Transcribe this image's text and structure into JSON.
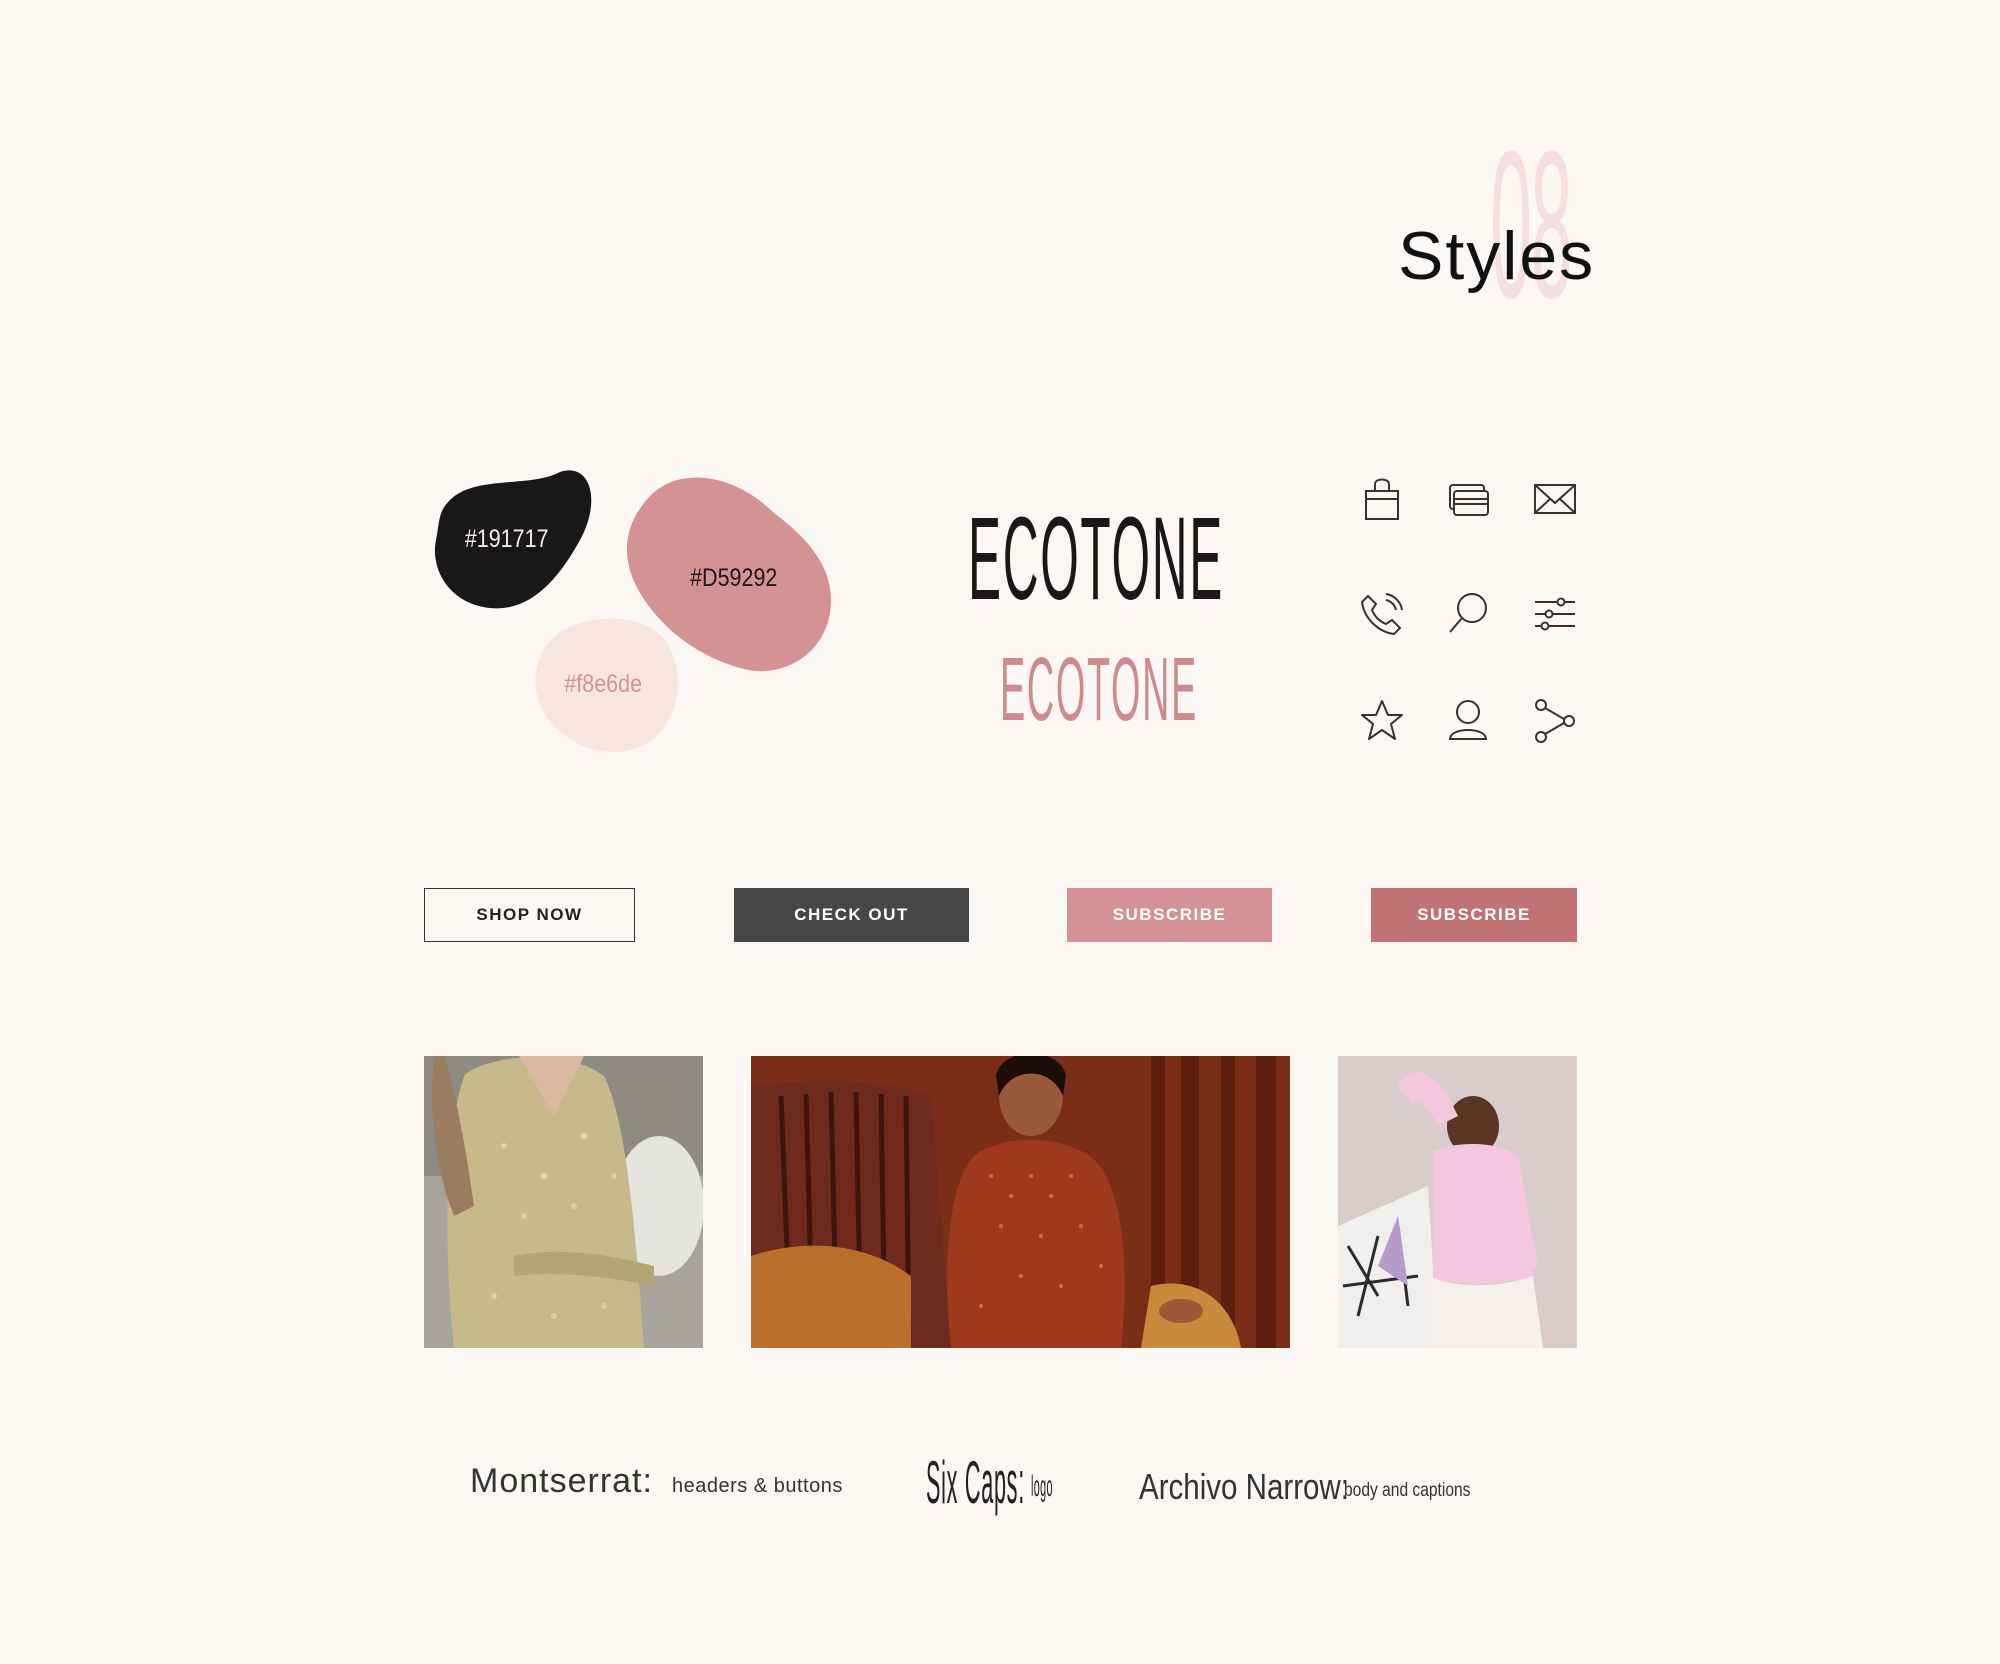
{
  "header": {
    "section_number": "08",
    "title": "Styles"
  },
  "palette": [
    {
      "label": "#191717",
      "color": "#191717",
      "text_color": "#f4ece8"
    },
    {
      "label": "#D59292",
      "color": "#D59292",
      "text_color": "#191717"
    },
    {
      "label": "#f8e6de",
      "color": "#f8e6de",
      "text_color": "#d59292"
    }
  ],
  "wordmarks": {
    "primary": "ECOTONE",
    "secondary": "ECOTONE"
  },
  "icons": [
    "shopping-bag-icon",
    "credit-card-icon",
    "mail-icon",
    "phone-icon",
    "search-icon",
    "filter-sliders-icon",
    "star-icon",
    "user-icon",
    "share-icon"
  ],
  "buttons": {
    "shop_now": "SHOP NOW",
    "check_out": "CHECK OUT",
    "subscribe_light": "SUBSCRIBE",
    "subscribe_dark": "SUBSCRIBE"
  },
  "fonts": {
    "montserrat_name": "Montserrat:",
    "montserrat_use": "headers & buttons",
    "sixcaps_name": "Six Caps:",
    "sixcaps_use": "logo",
    "archivo_name": "Archivo Narrow:",
    "archivo_use": "body and captions"
  }
}
